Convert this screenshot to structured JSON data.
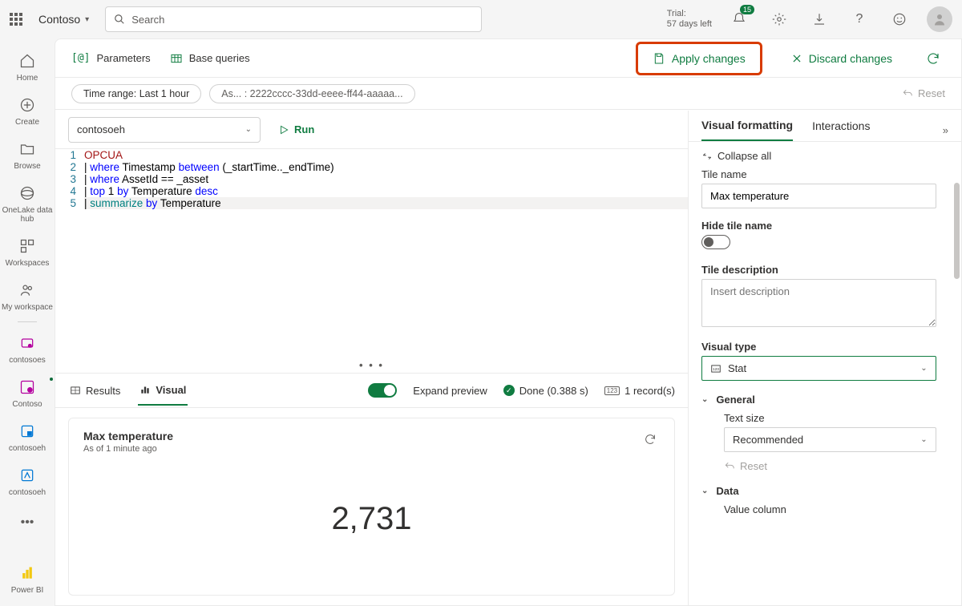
{
  "topbar": {
    "org": "Contoso",
    "search_placeholder": "Search",
    "trial_label": "Trial:",
    "trial_days": "57 days left",
    "notif_count": "15"
  },
  "rail": {
    "home": "Home",
    "create": "Create",
    "browse": "Browse",
    "onelake": "OneLake data hub",
    "workspaces": "Workspaces",
    "my_workspace": "My workspace",
    "contosoes": "contosoes",
    "contoso": "Contoso",
    "contosoeh1": "contosoeh",
    "contosoeh2": "contosoeh",
    "powerbi": "Power BI"
  },
  "header": {
    "parameters": "Parameters",
    "base_queries": "Base queries",
    "apply": "Apply changes",
    "discard": "Discard changes"
  },
  "filters": {
    "time_range": "Time range: Last 1 hour",
    "asset": "As... : 2222cccc-33dd-eeee-ff44-aaaaa...",
    "reset": "Reset"
  },
  "editor": {
    "db": "contosoeh",
    "run": "Run",
    "lines": {
      "l1": "OPCUA",
      "l2a": "| ",
      "l2b": "where",
      "l2c": " Timestamp ",
      "l2d": "between",
      "l2e": " (_startTime.._endTime)",
      "l3a": "| ",
      "l3b": "where",
      "l3c": " AssetId == _asset",
      "l4a": "| ",
      "l4b": "top",
      "l4c": " 1 ",
      "l4d": "by",
      "l4e": " Temperature ",
      "l4f": "desc",
      "l5a": "| ",
      "l5b": "summarize",
      "l5c": " ",
      "l5d": "by",
      "l5e": " Temperature"
    }
  },
  "tabs": {
    "results": "Results",
    "visual": "Visual",
    "expand": "Expand preview",
    "done": "Done (0.388 s)",
    "records": "1 record(s)"
  },
  "preview": {
    "title": "Max temperature",
    "subtitle": "As of 1 minute ago",
    "value": "2,731"
  },
  "side": {
    "tab_formatting": "Visual formatting",
    "tab_interactions": "Interactions",
    "collapse_all": "Collapse all",
    "tile_name_label": "Tile name",
    "tile_name_value": "Max temperature",
    "hide_tile_label": "Hide tile name",
    "tile_desc_label": "Tile description",
    "tile_desc_placeholder": "Insert description",
    "visual_type_label": "Visual type",
    "visual_type_value": "Stat",
    "general": "General",
    "text_size_label": "Text size",
    "text_size_value": "Recommended",
    "reset": "Reset",
    "data": "Data",
    "value_col": "Value column"
  },
  "chart_data": {
    "type": "table",
    "title": "Max temperature",
    "values": [
      2731
    ],
    "visual_type": "Stat"
  }
}
